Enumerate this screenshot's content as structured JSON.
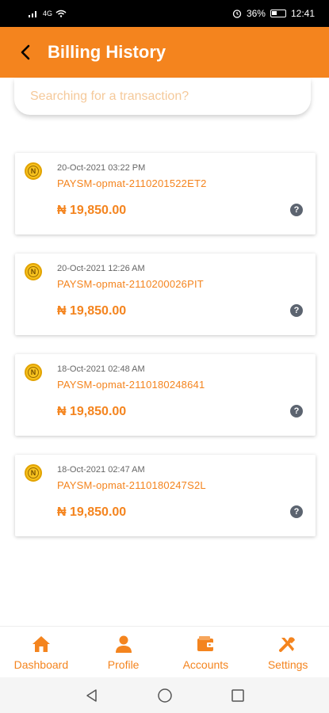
{
  "status_bar": {
    "signal_text": "4G",
    "battery": "36%",
    "time": "12:41"
  },
  "header": {
    "title": "Billing History"
  },
  "search": {
    "placeholder": "Searching for a transaction?"
  },
  "transactions": [
    {
      "date": "20-Oct-2021 03:22 PM",
      "reference": "PAYSM-opmat-2110201522ET2",
      "amount": "₦ 19,850.00"
    },
    {
      "date": "20-Oct-2021 12:26 AM",
      "reference": "PAYSM-opmat-2110200026PIT",
      "amount": "₦ 19,850.00"
    },
    {
      "date": "18-Oct-2021 02:48 AM",
      "reference": "PAYSM-opmat-2110180248641",
      "amount": "₦ 19,850.00"
    },
    {
      "date": "18-Oct-2021 02:47 AM",
      "reference": "PAYSM-opmat-2110180247S2L",
      "amount": "₦ 19,850.00"
    }
  ],
  "coin_symbol": "N",
  "help_symbol": "?",
  "bottom_nav": [
    {
      "label": "Dashboard",
      "icon": "home-icon"
    },
    {
      "label": "Profile",
      "icon": "person-icon"
    },
    {
      "label": "Accounts",
      "icon": "wallet-icon"
    },
    {
      "label": "Settings",
      "icon": "tools-icon"
    }
  ],
  "colors": {
    "accent": "#f4841e",
    "status_bar": "#000000",
    "placeholder": "#f5c99a"
  }
}
